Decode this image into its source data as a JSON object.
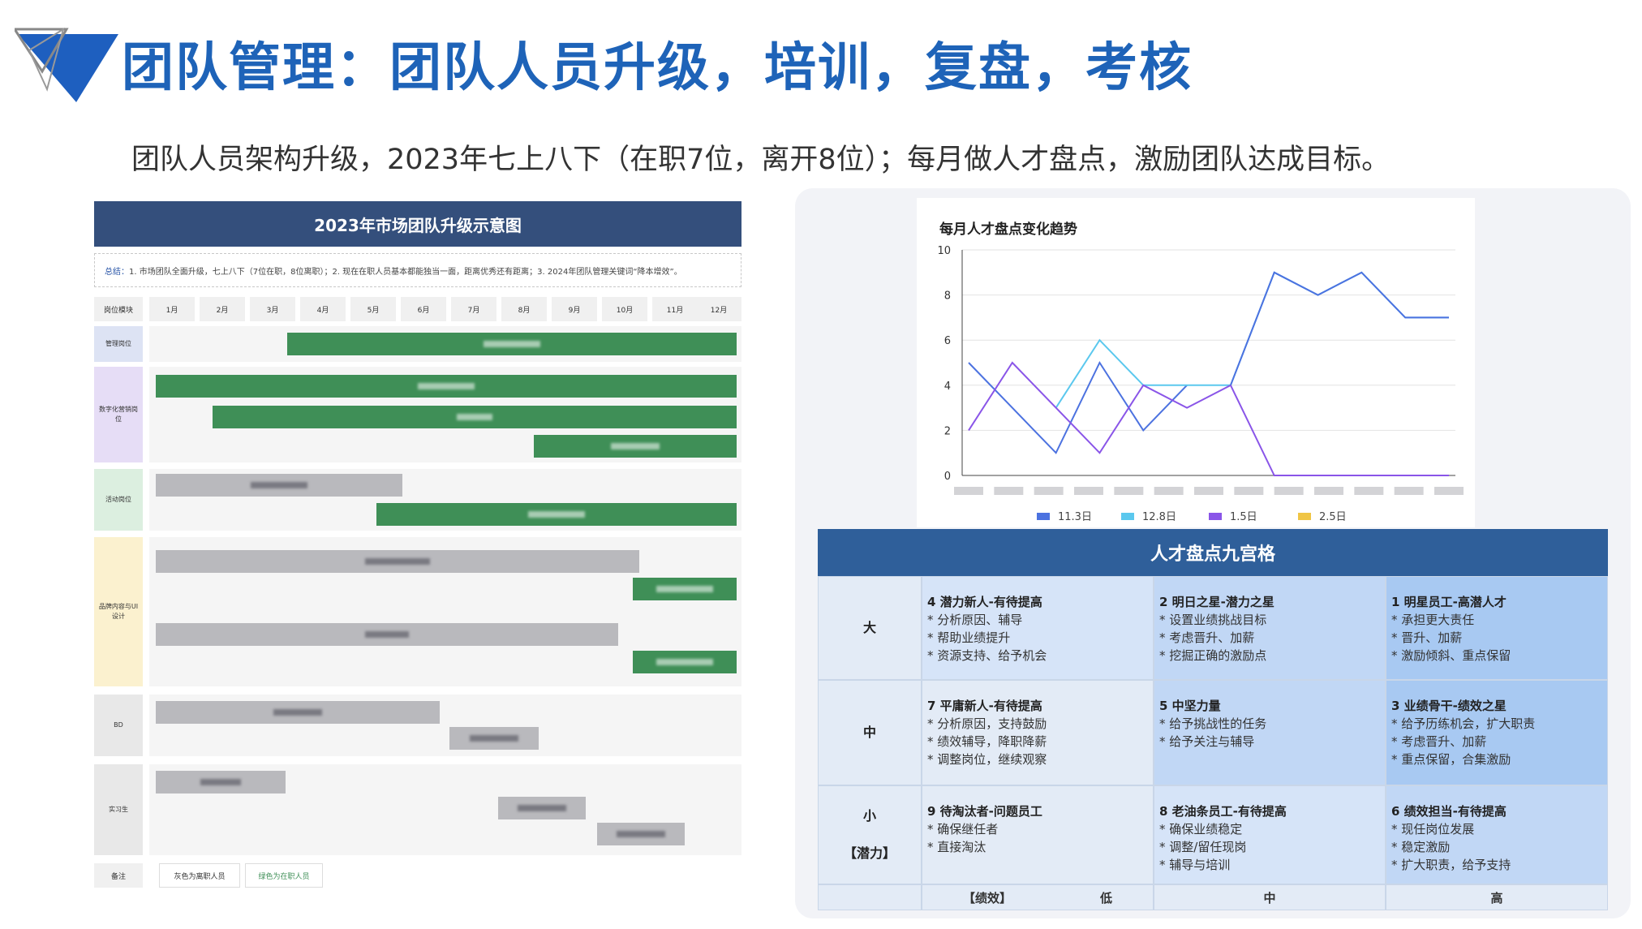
{
  "header": {
    "title": "团队管理：团队人员升级，培训，复盘，考核",
    "subtitle": "团队人员架构升级，2023年七上八下（在职7位，离开8位）；每月做人才盘点，激励团队达成目标。"
  },
  "gantt": {
    "title": "2023年市场团队升级示意图",
    "summary_key": "总结：",
    "summary": "1. 市场团队全面升级，七上八下（7位在职，8位离职）；2. 现在在职人员基本都能独当一面，距离优秀还有距离；3. 2024年团队管理关键词“降本增效”。",
    "corner": "岗位模块",
    "months": [
      "1月",
      "2月",
      "3月",
      "4月",
      "5月",
      "6月",
      "7月",
      "8月",
      "9月",
      "10月",
      "11月",
      "12月"
    ],
    "rows": [
      {
        "label": "管理岗位",
        "color": "#dde3f4"
      },
      {
        "label": "数字化营销岗位",
        "color": "#e6ddf6"
      },
      {
        "label": "活动岗位",
        "color": "#dcefe0"
      },
      {
        "label": "品牌内容与UI设计",
        "color": "#fbf1cf"
      },
      {
        "label": "BD",
        "color": "#e8e8e8"
      },
      {
        "label": "实习生",
        "color": "#e8e8e8"
      }
    ],
    "note_label": "备注",
    "note_gray": "灰色为离职人员",
    "note_green": "绿色为在职人员"
  },
  "chart_data": {
    "type": "line",
    "title": "每月人才盘点变化趋势",
    "ylim": [
      0,
      10
    ],
    "yticks": [
      0,
      2,
      4,
      6,
      8,
      10
    ],
    "categories": [
      "",
      "",
      "",
      "",
      "",
      "",
      "",
      "",
      "",
      "",
      "",
      "",
      ""
    ],
    "series": [
      {
        "name": "11.3日",
        "color": "#4c72e0",
        "values": [
          5,
          3,
          1,
          5,
          2,
          4,
          null,
          null,
          null,
          null,
          null,
          null,
          null
        ]
      },
      {
        "name": "12.8日",
        "color": "#5bc8ee",
        "values": [
          null,
          null,
          3,
          6,
          4,
          4,
          4,
          9,
          8,
          9,
          7,
          7,
          null
        ]
      },
      {
        "name": "1.5日",
        "color": "#8a55e8",
        "values": [
          2,
          5,
          3,
          1,
          4,
          3,
          4,
          0,
          0,
          0,
          0,
          0,
          null
        ]
      },
      {
        "name": "2.5日",
        "color": "#f0c545",
        "values": []
      }
    ],
    "grid": true,
    "legend": "bottom"
  },
  "chart_overlay": {
    "blue_tail": [
      null,
      null,
      null,
      null,
      null,
      null,
      4,
      9,
      8,
      9,
      7,
      7
    ]
  },
  "ninegrid": {
    "title": "人才盘点九宫格",
    "row_labels": [
      "大",
      "中",
      "小"
    ],
    "row_extra": "【潜力】",
    "col_axis": "【绩效】",
    "col_labels": [
      "低",
      "中",
      "高"
    ],
    "cells": [
      {
        "title": "4 潜力新人-有待提高",
        "items": [
          "* 分析原因、辅导",
          "* 帮助业绩提升",
          "* 资源支持、给予机会"
        ],
        "color": "#d6e4f8"
      },
      {
        "title": "2 明日之星-潜力之星",
        "items": [
          "* 设置业绩挑战目标",
          "* 考虑晋升、加薪",
          "* 挖掘正确的激励点"
        ],
        "color": "#c1d7f5"
      },
      {
        "title": "1 明星员工-高潜人才",
        "items": [
          "* 承担更大责任",
          "* 晋升、加薪",
          "* 激励倾斜、重点保留"
        ],
        "color": "#a8c9f2"
      },
      {
        "title": "7 平庸新人-有待提高",
        "items": [
          "* 分析原因，支持鼓励",
          "* 绩效辅导，降职降薪",
          "* 调整岗位，继续观察"
        ],
        "color": "#e3ebf6"
      },
      {
        "title": "5 中坚力量",
        "items": [
          "* 给予挑战性的任务",
          "* 给予关注与辅导"
        ],
        "color": "#c1d7f5"
      },
      {
        "title": "3 业绩骨干-绩效之星",
        "items": [
          "* 给予历练机会，扩大职责",
          "* 考虑晋升、加薪",
          "* 重点保留，合集激励"
        ],
        "color": "#a8c9f2"
      },
      {
        "title": "9 待淘汰者-问题员工",
        "items": [
          "* 确保继任者",
          "* 直接淘汰"
        ],
        "color": "#e3ebf6"
      },
      {
        "title": "8 老油条员工-有待提高",
        "items": [
          "* 确保业绩稳定",
          "* 调整/留任现岗",
          "* 辅导与培训"
        ],
        "color": "#d6e4f8"
      },
      {
        "title": "6 绩效担当-有待提高",
        "items": [
          "* 现任岗位发展",
          "* 稳定激励",
          "* 扩大职责，给予支持"
        ],
        "color": "#c1d7f5"
      }
    ]
  },
  "colors": {
    "title_blue": "#1e63b8",
    "header_navy": "#344f7c",
    "green_bar": "#3f8f57",
    "gray_bar": "#b9b9bd"
  }
}
